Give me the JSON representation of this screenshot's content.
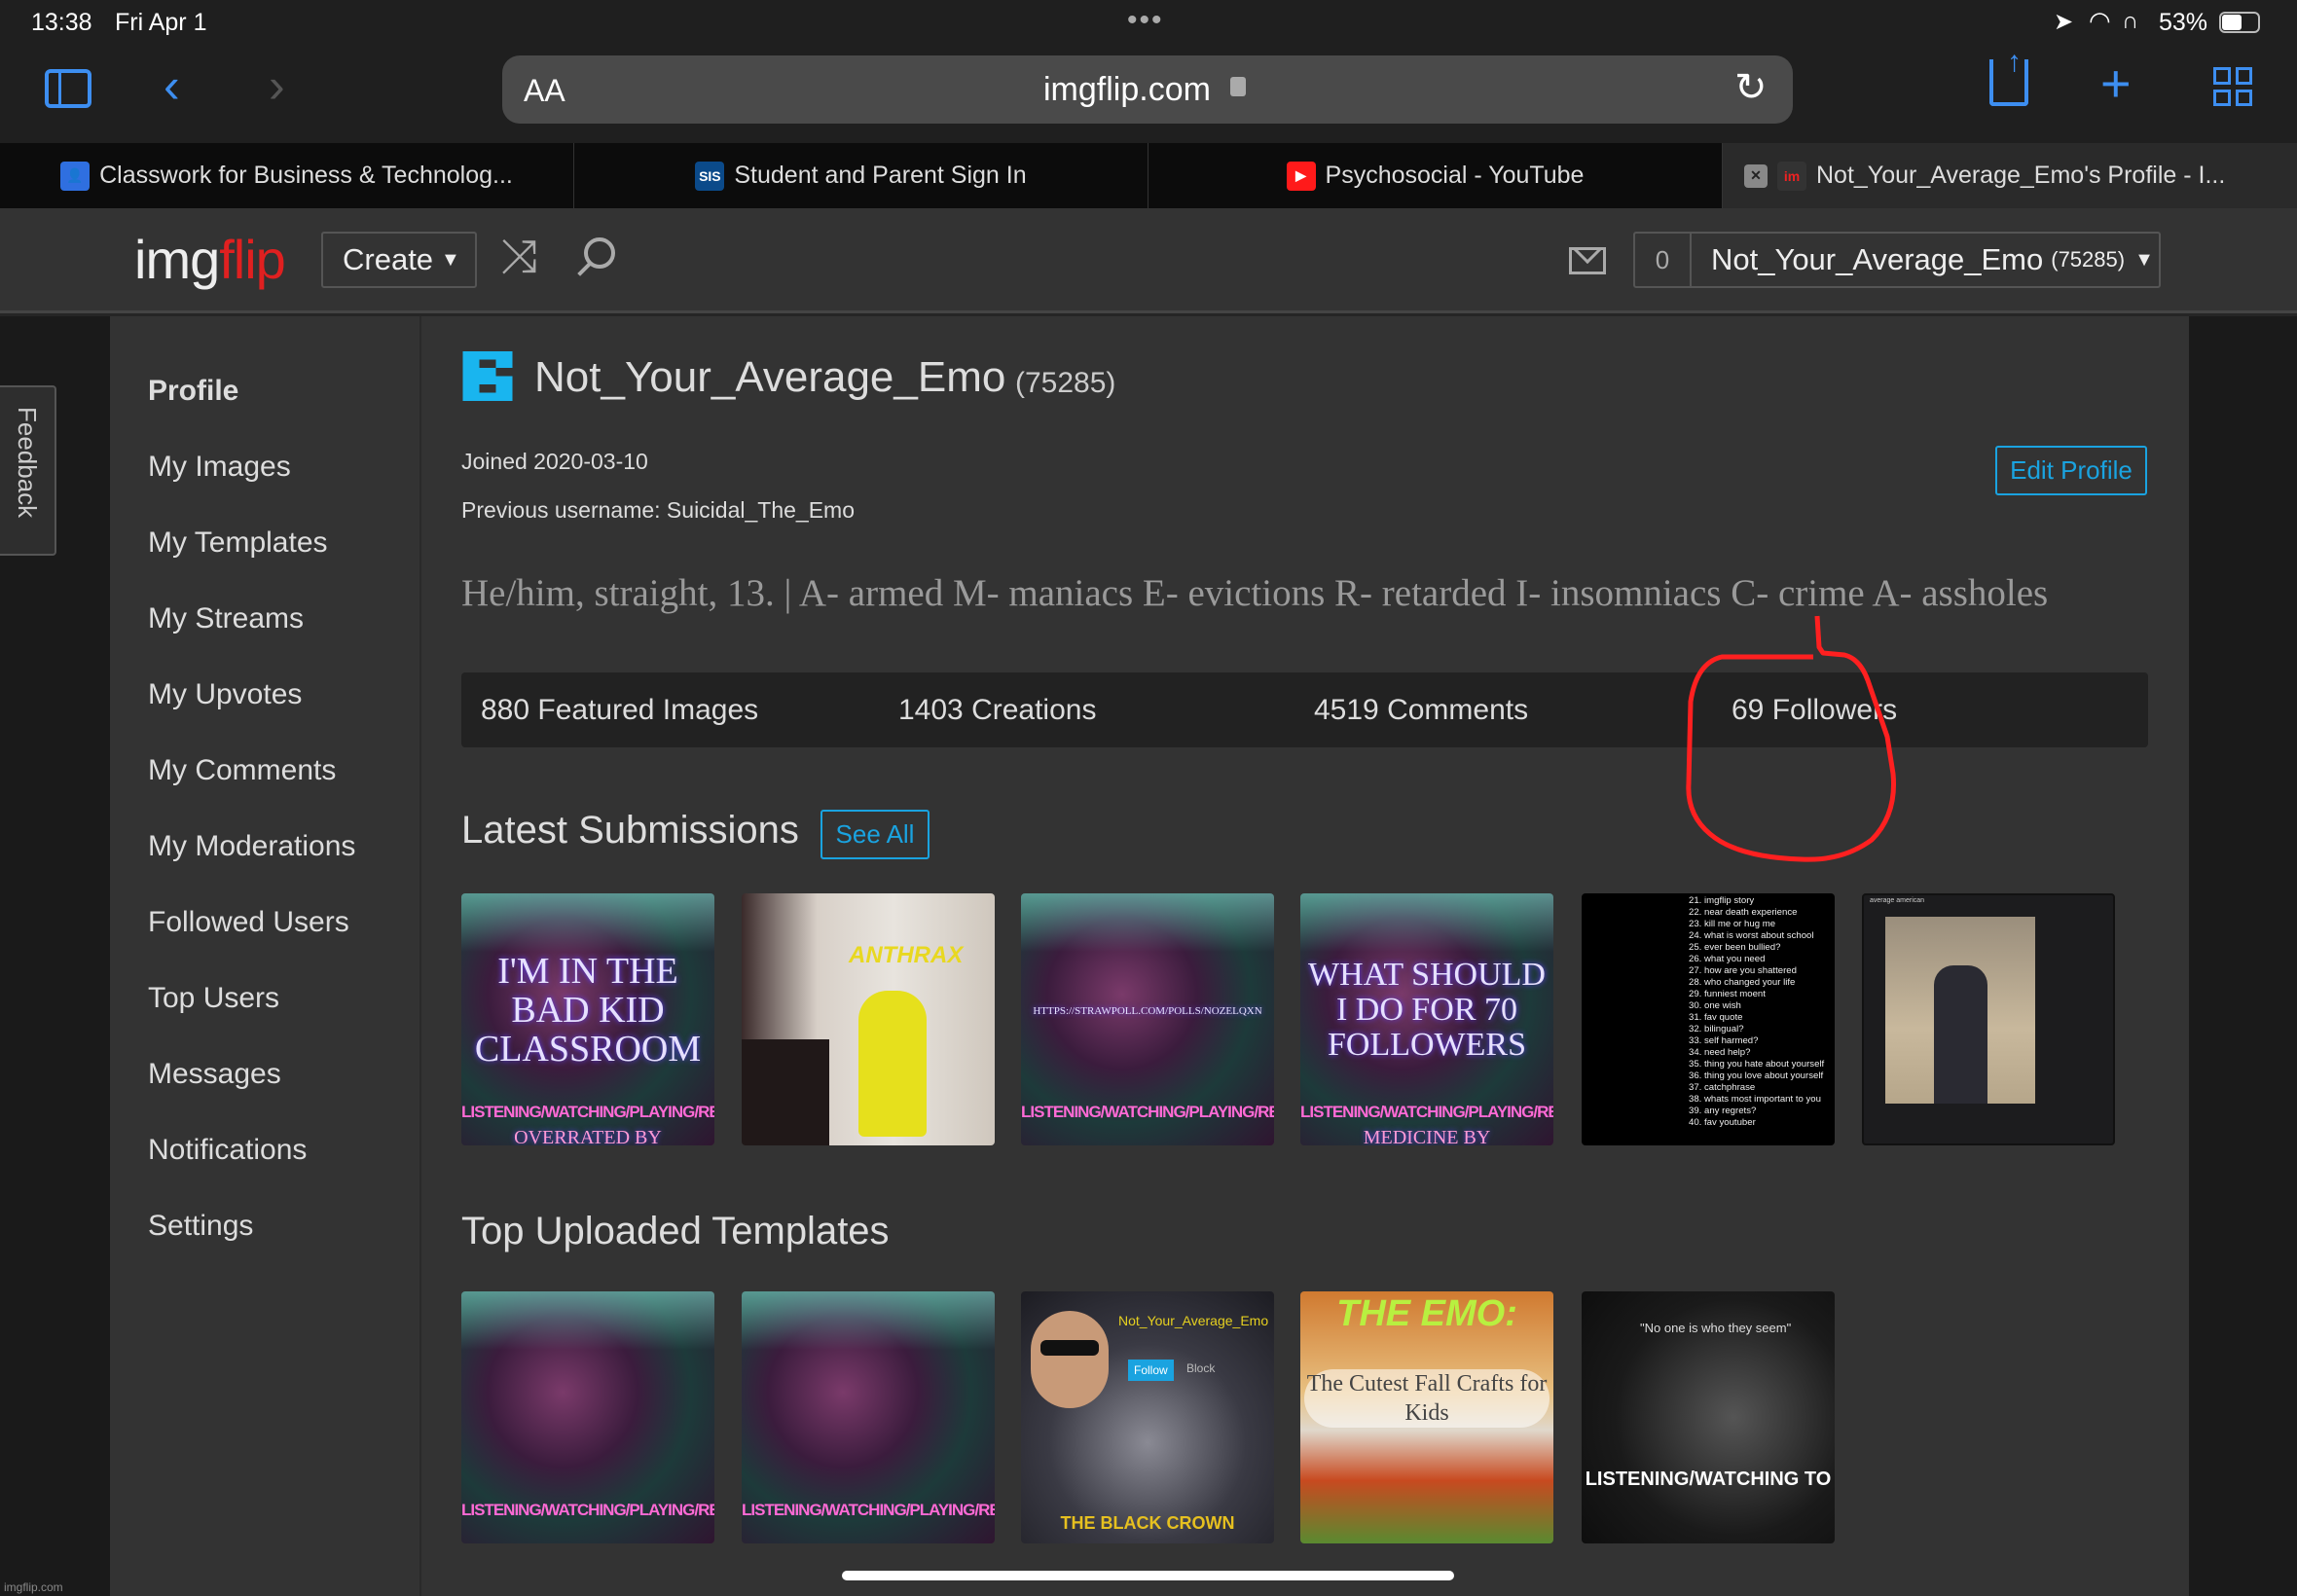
{
  "status_bar": {
    "time": "13:38",
    "date": "Fri Apr 1",
    "battery": "53%"
  },
  "browser": {
    "text_size_label": "AA",
    "url": "imgflip.com",
    "icons": [
      "sidebar-icon",
      "back-icon",
      "forward-icon",
      "lock-icon",
      "reload-icon",
      "share-icon",
      "new-tab-icon",
      "tabs-overview-icon"
    ]
  },
  "tabs": [
    {
      "label": "Classwork for Business & Technolog...",
      "favicon": "classroom",
      "color": "#2f6fe0"
    },
    {
      "label": "Student and Parent Sign In",
      "favicon": "SIS",
      "color": "#0b4a8a"
    },
    {
      "label": "Psychosocial - YouTube",
      "favicon": "youtube",
      "color": "#ff1a1a"
    },
    {
      "label": "Not_Your_Average_Emo's Profile - I...",
      "favicon": "im",
      "active": true
    }
  ],
  "header": {
    "logo_img": "img",
    "logo_flip": "flip",
    "create_label": "Create",
    "notification_count": "0",
    "username": "Not_Your_Average_Emo",
    "points": "(75285)"
  },
  "feedback_label": "Feedback",
  "sidebar": {
    "items": [
      {
        "label": "Profile",
        "active": true
      },
      {
        "label": "My Images"
      },
      {
        "label": "My Templates"
      },
      {
        "label": "My Streams"
      },
      {
        "label": "My Upvotes"
      },
      {
        "label": "My Comments"
      },
      {
        "label": "My Moderations"
      },
      {
        "label": "Followed Users"
      },
      {
        "label": "Top Users"
      },
      {
        "label": "Messages"
      },
      {
        "label": "Notifications"
      },
      {
        "label": "Settings"
      }
    ]
  },
  "profile": {
    "username": "Not_Your_Average_Emo",
    "points": "(75285)",
    "joined": "Joined 2020-03-10",
    "previous_username": "Previous username: Suicidal_The_Emo",
    "edit_label": "Edit Profile",
    "bio": "He/him, straight, 13. | A- armed M- maniacs E- evictions R- retarded I- insomniacs C- crime A- assholes",
    "stats": [
      "880 Featured Images",
      "1403 Creations",
      "4519 Comments",
      "69 Followers"
    ],
    "accent": "#1aa3e0"
  },
  "latest": {
    "title": "Latest Submissions",
    "see_all": "See All",
    "items": [
      {
        "caption": "I'M IN THE BAD KID CLASSROOM",
        "bar": "LISTENING/WATCHING/PLAYING/READING",
        "bottom": "OVERRATED BY"
      },
      {
        "caption": "ANTHRAX"
      },
      {
        "caption": "HTTPS://STRAWPOLL.COM/POLLS/NOZELQXN",
        "bar": "LISTENING/WATCHING/PLAYING/READING"
      },
      {
        "caption": "WHAT SHOULD I DO FOR 70 FOLLOWERS",
        "bar": "LISTENING/WATCHING/PLAYING/READING",
        "bottom": "MEDICINE BY"
      },
      {
        "lines": [
          "21. imgflip story",
          "22. near death experience",
          "23. kill me or hug me",
          "24. what is worst about school",
          "25. ever been bullied?",
          "26. what you need",
          "27. how are you shattered",
          "28. who changed your life",
          "29. funniest moent",
          "30. one wish",
          "31. fav quote",
          "32. bilingual?",
          "33. self harmed?",
          "34. need help?",
          "35. thing you hate about yourself",
          "36. thing you love about yourself",
          "37. catchphrase",
          "38. whats most important to you",
          "39. any regrets?",
          "40. fav youtuber"
        ]
      },
      {
        "caption": "average american"
      }
    ]
  },
  "templates": {
    "title": "Top Uploaded Templates",
    "items": [
      {
        "bar": "LISTENING/WATCHING/PLAYING/READING"
      },
      {
        "bar": "LISTENING/WATCHING/PLAYING/READING"
      },
      {
        "name": "Not_Your_Average_Emo",
        "follow": "Follow",
        "block": "Block",
        "bottom": "THE BLACK CROWN"
      },
      {
        "top": "THE EMO:",
        "middle": "The Cutest Fall Crafts for Kids"
      },
      {
        "quote": "\"No one is who they seem\"",
        "bottom": "LISTENING/WATCHING TO"
      }
    ]
  },
  "footer_mark": "imgflip.com",
  "annotation_color": "#ff2020"
}
